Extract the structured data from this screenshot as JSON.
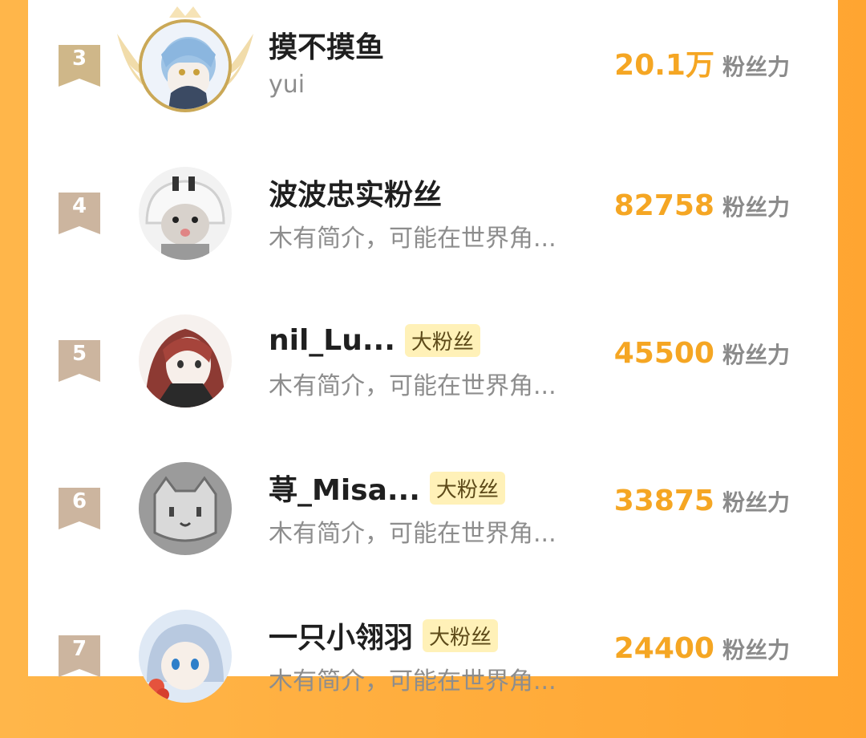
{
  "colors": {
    "accent": "#f5a623",
    "frame": "#ffa531",
    "rank_gold": "#cfb789",
    "rank_muted": "#ccb59f",
    "badge_bg": "#fff1b8"
  },
  "leaderboard": {
    "entries": [
      {
        "rank": "3",
        "name": "摸不摸鱼",
        "bio": "yui",
        "score": "20.1万",
        "score_unit": "粉丝力",
        "badge": "",
        "avatar_icon": "crowned-avatar"
      },
      {
        "rank": "4",
        "name": "波波忠实粉丝",
        "bio": "木有简介，可能在世界角...",
        "score": "82758",
        "score_unit": "粉丝力",
        "badge": "",
        "avatar_icon": "cat-avatar"
      },
      {
        "rank": "5",
        "name": "nil_Lu...",
        "bio": "木有简介，可能在世界角...",
        "score": "45500",
        "score_unit": "粉丝力",
        "badge": "大粉丝",
        "avatar_icon": "anime-girl-avatar"
      },
      {
        "rank": "6",
        "name": "荨_Misa...",
        "bio": "木有简介，可能在世界角...",
        "score": "33875",
        "score_unit": "粉丝力",
        "badge": "大粉丝",
        "avatar_icon": "cartoon-cat-avatar"
      },
      {
        "rank": "7",
        "name": "一只小翎羽",
        "bio": "木有简介，可能在世界角...",
        "score": "24400",
        "score_unit": "粉丝力",
        "badge": "大粉丝",
        "avatar_icon": "anime-avatar"
      }
    ]
  }
}
